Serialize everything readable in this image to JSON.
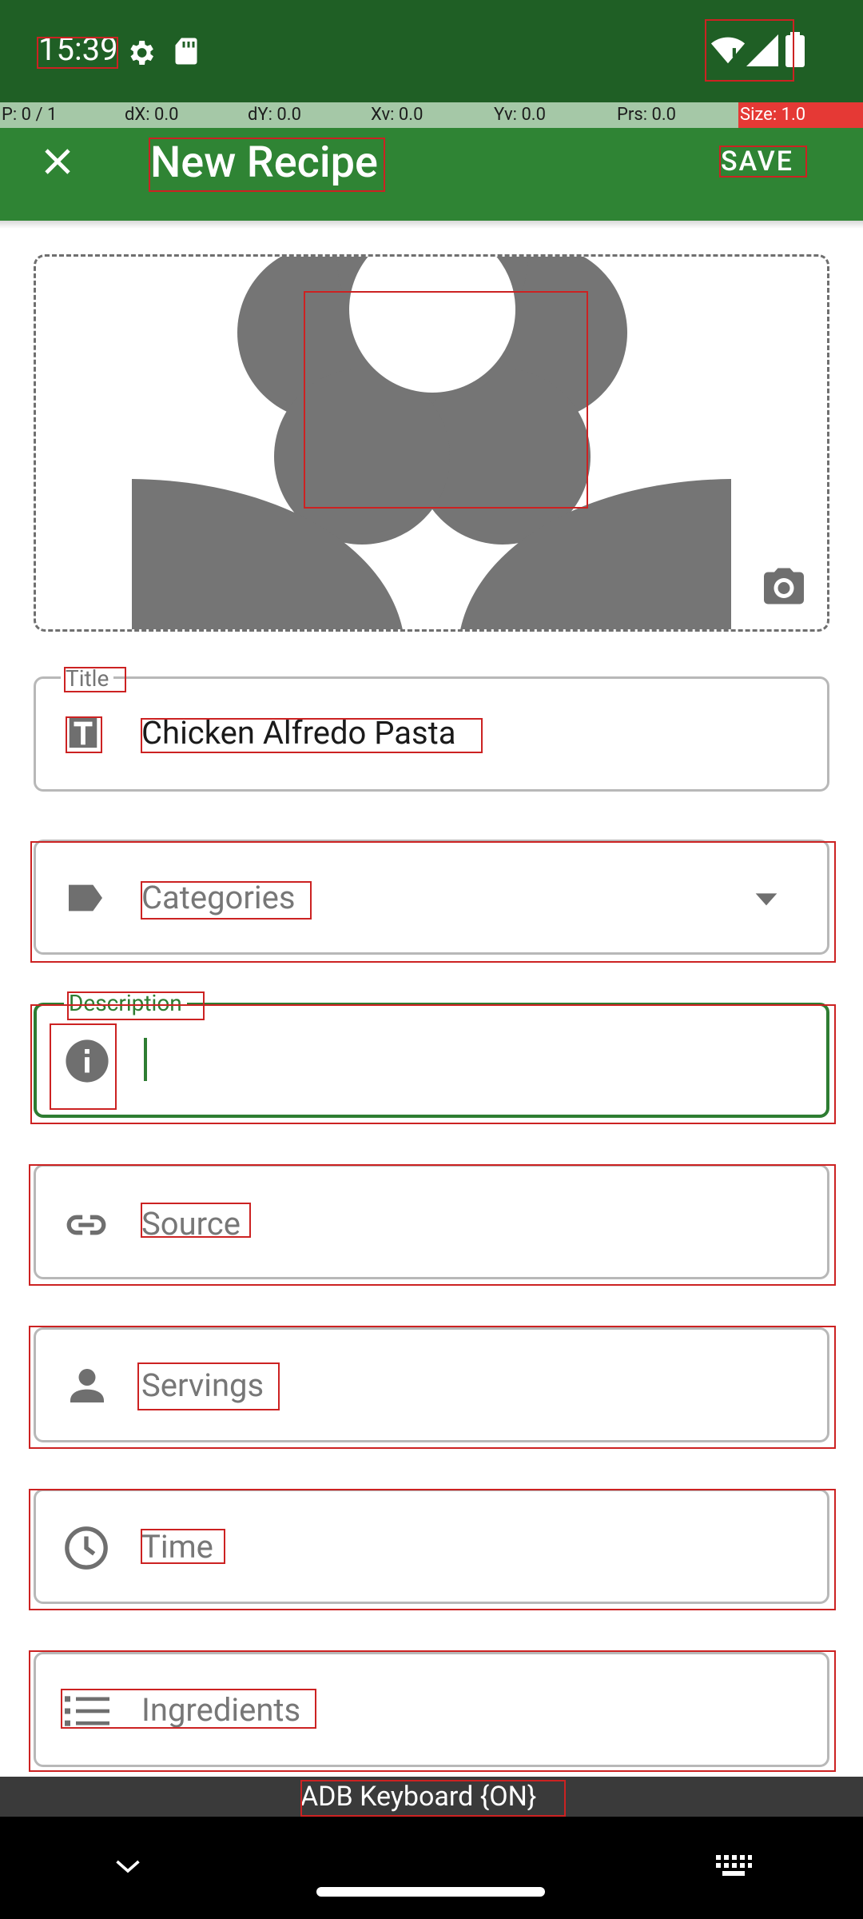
{
  "status_bar": {
    "time": "15:39"
  },
  "debug_bar": {
    "p": "P: 0 / 1",
    "dx": "dX: 0.0",
    "dy": "dY: 0.0",
    "xv": "Xv: 0.0",
    "yv": "Yv: 0.0",
    "prs": "Prs: 0.0",
    "size": "Size: 1.0"
  },
  "app_bar": {
    "title": "New Recipe",
    "save_label": "SAVE"
  },
  "form": {
    "title_field": {
      "label": "Title",
      "value": "Chicken Alfredo Pasta"
    },
    "categories_field": {
      "placeholder": "Categories"
    },
    "description_field": {
      "label": "Description",
      "value": ""
    },
    "source_field": {
      "placeholder": "Source"
    },
    "servings_field": {
      "placeholder": "Servings"
    },
    "time_field": {
      "placeholder": "Time"
    },
    "ingredients_field": {
      "placeholder": "Ingredients"
    }
  },
  "keyboard_bar": {
    "text": "ADB Keyboard {ON}"
  },
  "colors": {
    "status_bar": "#1f5f25",
    "app_bar": "#2f8434",
    "accent": "#2e7d32",
    "icon_gray": "#6f6f6f"
  },
  "icons": [
    "close-icon",
    "camera-icon",
    "text-format-icon",
    "label-icon",
    "dropdown-icon",
    "info-icon",
    "link-icon",
    "person-icon",
    "clock-icon",
    "list-icon",
    "wifi-icon",
    "signal-icon",
    "battery-icon",
    "gear-icon",
    "sd-card-icon",
    "keyboard-icon",
    "chevron-down-icon"
  ]
}
